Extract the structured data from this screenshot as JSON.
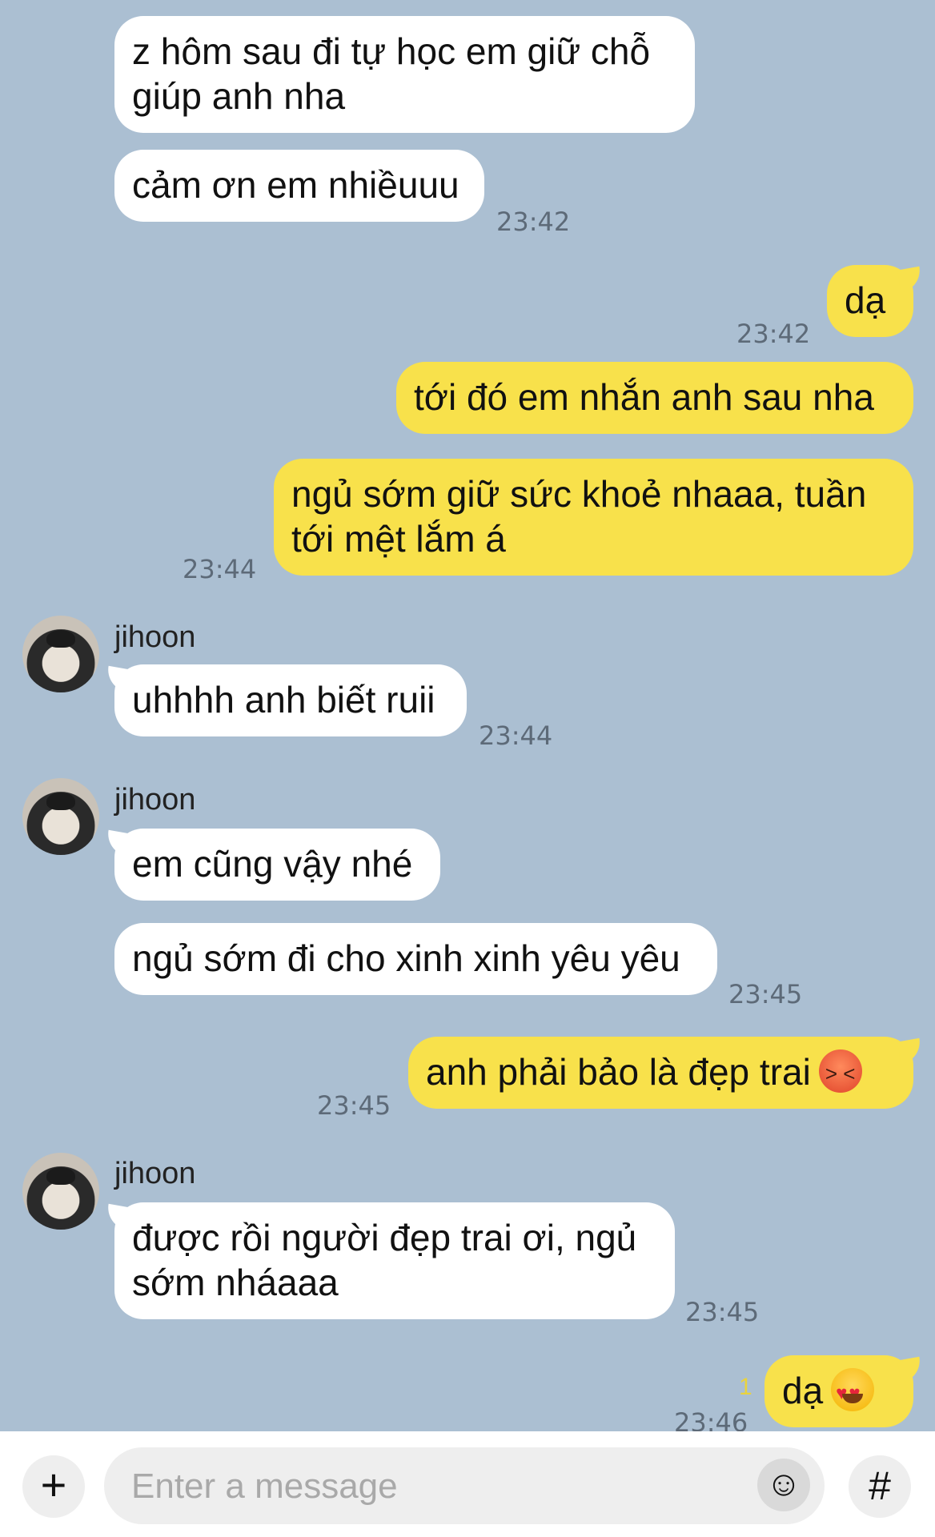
{
  "messages": {
    "m1": "z hôm sau đi tự học em giữ chỗ giúp anh nha",
    "m2": "cảm ơn em nhiềuuu",
    "m2_time": "23:42",
    "m3": "dạ",
    "m3_time": "23:42",
    "m4": "tới đó em nhắn anh sau nha",
    "m5": "ngủ sớm giữ sức khoẻ nhaaa, tuần tới mệt lắm á",
    "m5_time": "23:44",
    "sender": "jihoon",
    "m6": "uhhhh anh biết ruii",
    "m6_time": "23:44",
    "m7": "em cũng vậy nhé",
    "m8": "ngủ sớm đi cho xinh xinh yêu yêu",
    "m8_time": "23:45",
    "m9": "anh phải bảo là đẹp trai",
    "m9_emoji": "angry-face-emoji",
    "m9_time": "23:45",
    "m10": "được rồi người đẹp trai ơi, ngủ sớm nháaaa",
    "m10_time": "23:45",
    "m11": "dạ",
    "m11_emoji": "heart-eyes-emoji",
    "m11_unread": "1",
    "m11_time": "23:46"
  },
  "input": {
    "placeholder": "Enter a message",
    "plus_icon": "+",
    "emoji_icon": "☺",
    "hash_icon": "#"
  },
  "colors": {
    "background": "#abbfd2",
    "outgoing_bubble": "#f8e14b",
    "incoming_bubble": "#ffffff"
  }
}
